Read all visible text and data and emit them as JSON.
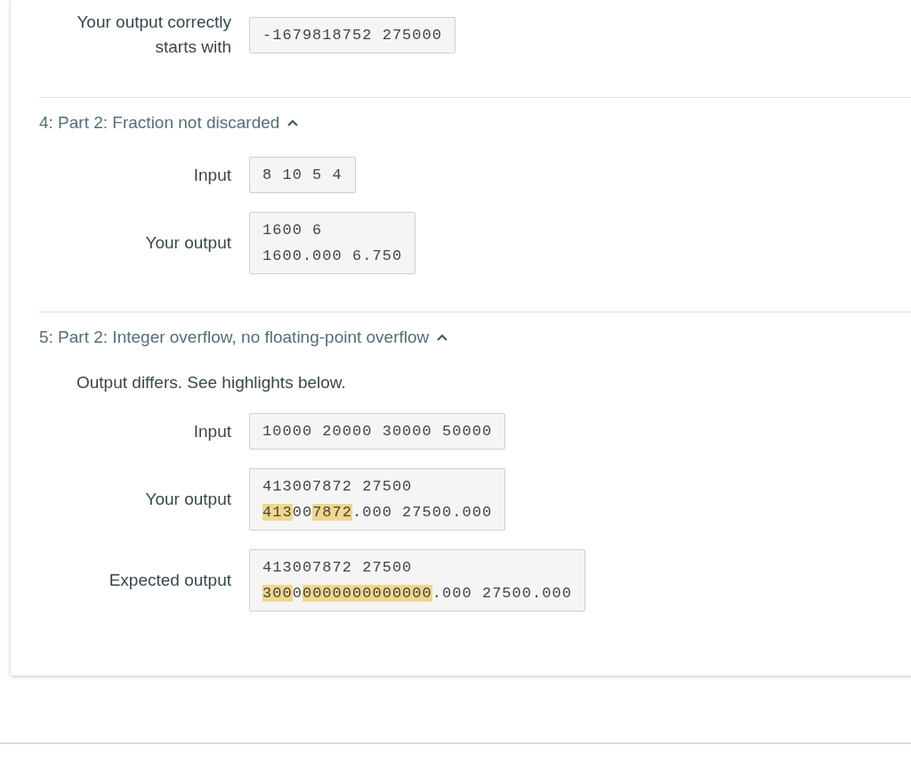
{
  "top_row": {
    "label": "Your output correctly starts with",
    "lines": [
      [
        {
          "text": "-1679818752 275000",
          "highlighted": false
        }
      ]
    ]
  },
  "tests": [
    {
      "title": "4: Part 2: Fraction not discarded",
      "expanded": true,
      "rows": [
        {
          "label": "Input",
          "lines": [
            [
              {
                "text": "8 10 5 4",
                "highlighted": false
              }
            ]
          ]
        },
        {
          "label": "Your output",
          "lines": [
            [
              {
                "text": "1600 6",
                "highlighted": false
              }
            ],
            [
              {
                "text": "1600.000 6.750",
                "highlighted": false
              }
            ]
          ]
        }
      ]
    },
    {
      "title": "5: Part 2: Integer overflow, no floating-point overflow",
      "expanded": true,
      "message": "Output differs. See highlights below.",
      "rows": [
        {
          "label": "Input",
          "lines": [
            [
              {
                "text": "10000 20000 30000 50000",
                "highlighted": false
              }
            ]
          ]
        },
        {
          "label": "Your output",
          "lines": [
            [
              {
                "text": "413007872 27500",
                "highlighted": false
              }
            ],
            [
              {
                "text": "413",
                "highlighted": true
              },
              {
                "text": "00",
                "highlighted": false
              },
              {
                "text": "7872",
                "highlighted": true
              },
              {
                "text": ".000 27500.000",
                "highlighted": false
              }
            ]
          ]
        },
        {
          "label": "Expected output",
          "lines": [
            [
              {
                "text": "413007872 27500",
                "highlighted": false
              }
            ],
            [
              {
                "text": "300",
                "highlighted": true
              },
              {
                "text": "0",
                "highlighted": false
              },
              {
                "text": "0000000000000",
                "highlighted": true
              },
              {
                "text": ".000 27500.000",
                "highlighted": false
              }
            ]
          ]
        }
      ]
    }
  ]
}
